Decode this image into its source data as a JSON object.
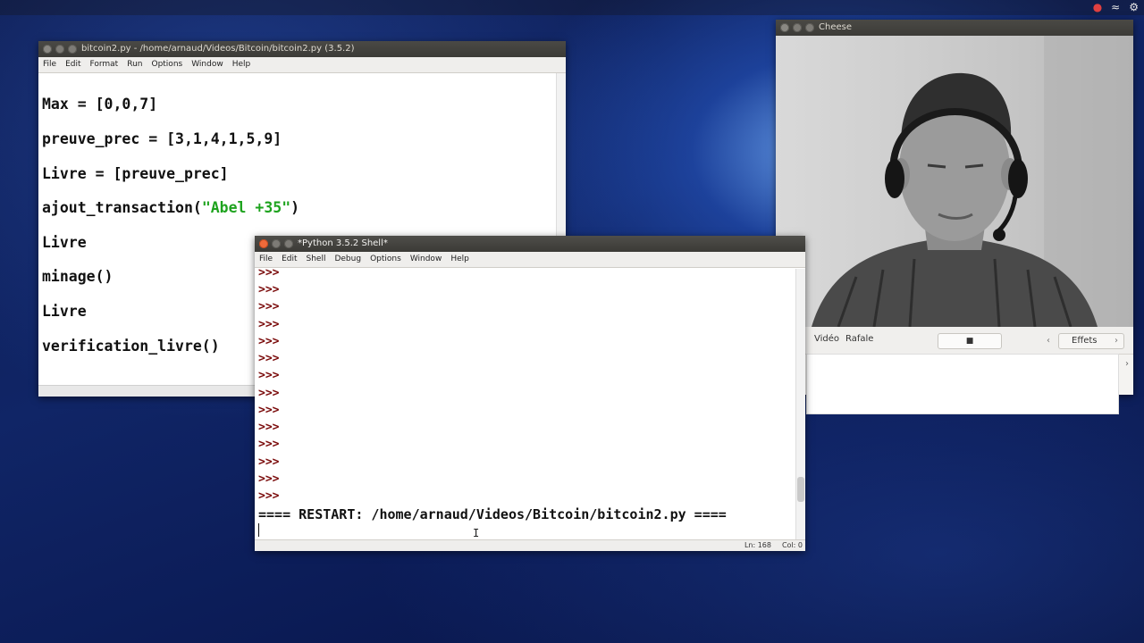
{
  "tray": {
    "icons": [
      "camera-recording-icon",
      "wifi-icon",
      "settings-icon"
    ]
  },
  "editor": {
    "title": "bitcoin2.py - /home/arnaud/Videos/Bitcoin/bitcoin2.py (3.5.2)",
    "menu": [
      "File",
      "Edit",
      "Format",
      "Run",
      "Options",
      "Window",
      "Help"
    ],
    "lines": {
      "l1": "Max = [0,0,7]",
      "l2": "preuve_prec = [3,1,4,1,5,9]",
      "l3": "Livre = [preuve_prec]",
      "l4_pre": "ajout_transaction(",
      "l4_str": "\"Abel +35\"",
      "l4_post": ")",
      "l5": "Livre",
      "l6": "minage()",
      "l7": "Livre",
      "l8": "verification_livre()"
    }
  },
  "shell": {
    "title": "*Python 3.5.2 Shell*",
    "menu": [
      "File",
      "Edit",
      "Shell",
      "Debug",
      "Options",
      "Window",
      "Help"
    ],
    "prompt": ">>>",
    "restart": "==== RESTART: /home/arnaud/Videos/Bitcoin/bitcoin2.py ====",
    "status_ln": "Ln: 168",
    "status_col": "Col: 0"
  },
  "cheese": {
    "title": "Cheese",
    "tabs": {
      "video": "Vidéo",
      "burst": "Rafale"
    },
    "effects": "Effets"
  },
  "colors": {
    "string": "#1ea31e",
    "prompt": "#7a0a0a",
    "close_button": "#ef6a3a"
  }
}
